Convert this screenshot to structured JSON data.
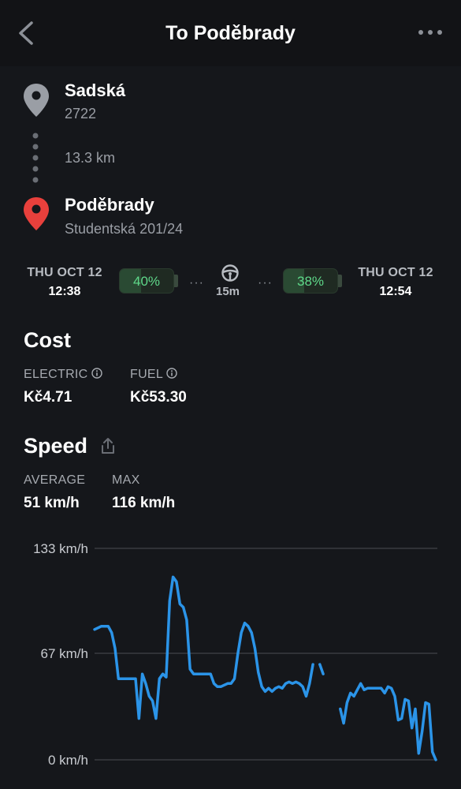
{
  "header": {
    "title": "To Poděbrady"
  },
  "route": {
    "origin": {
      "name": "Sadská",
      "address": "2722"
    },
    "distance": "13.3 km",
    "destination": {
      "name": "Poděbrady",
      "address": "Studentská 201/24"
    }
  },
  "trip": {
    "start": {
      "date": "THU OCT 12",
      "time": "12:38",
      "battery": "40%",
      "battery_level": 0.4
    },
    "duration": "15m",
    "end": {
      "date": "THU OCT 12",
      "time": "12:54",
      "battery": "38%",
      "battery_level": 0.38
    }
  },
  "cost": {
    "title": "Cost",
    "electric_label": "ELECTRIC",
    "electric_value": "Kč4.71",
    "fuel_label": "FUEL",
    "fuel_value": "Kč53.30"
  },
  "speed": {
    "title": "Speed",
    "average_label": "AVERAGE",
    "average_value": "51 km/h",
    "max_label": "MAX",
    "max_value": "116 km/h"
  },
  "colors": {
    "accent": "#2b94e8",
    "battery_text": "#5fd98a",
    "destination_pin": "#e8403c",
    "origin_pin": "#9a9ea5"
  },
  "chart_data": {
    "type": "line",
    "y_ticks": [
      "133 km/h",
      "67 km/h",
      "0 km/h"
    ],
    "ylim": [
      0,
      133
    ],
    "grid": true,
    "series": [
      {
        "segments": [
          [
            [
              0,
              82
            ],
            [
              2,
              84
            ],
            [
              4,
              84
            ],
            [
              5,
              80
            ],
            [
              6,
              70
            ],
            [
              7,
              51
            ],
            [
              8,
              51
            ],
            [
              9,
              51
            ],
            [
              10,
              51
            ],
            [
              11,
              51
            ],
            [
              12,
              51
            ],
            [
              13,
              26
            ],
            [
              14,
              54
            ],
            [
              15,
              48
            ],
            [
              16,
              40
            ],
            [
              17,
              37
            ],
            [
              18,
              26
            ],
            [
              19,
              51
            ],
            [
              20,
              54
            ],
            [
              21,
              52
            ],
            [
              22,
              100
            ],
            [
              23,
              115
            ],
            [
              24,
              112
            ],
            [
              25,
              98
            ],
            [
              26,
              96
            ],
            [
              27,
              88
            ],
            [
              28,
              57
            ],
            [
              29,
              54
            ],
            [
              30,
              54
            ],
            [
              31,
              54
            ],
            [
              32,
              54
            ],
            [
              33,
              54
            ],
            [
              34,
              54
            ],
            [
              35,
              48
            ],
            [
              36,
              46
            ],
            [
              37,
              46
            ],
            [
              38,
              47
            ],
            [
              39,
              48
            ],
            [
              40,
              48
            ],
            [
              41,
              51
            ],
            [
              42,
              67
            ],
            [
              43,
              80
            ],
            [
              44,
              86
            ],
            [
              45,
              84
            ],
            [
              46,
              80
            ],
            [
              47,
              70
            ],
            [
              48,
              55
            ],
            [
              49,
              46
            ],
            [
              50,
              43
            ],
            [
              51,
              45
            ],
            [
              52,
              43
            ],
            [
              53,
              45
            ],
            [
              54,
              46
            ],
            [
              55,
              45
            ],
            [
              56,
              48
            ],
            [
              57,
              49
            ],
            [
              58,
              48
            ],
            [
              59,
              49
            ],
            [
              60,
              48
            ],
            [
              61,
              46
            ],
            [
              62,
              40
            ],
            [
              63,
              48
            ],
            [
              64,
              60
            ]
          ],
          [
            [
              66,
              60
            ],
            [
              67,
              54
            ]
          ],
          [
            [
              72,
              32
            ],
            [
              73,
              23
            ],
            [
              74,
              36
            ],
            [
              75,
              42
            ],
            [
              76,
              40
            ],
            [
              77,
              44
            ],
            [
              78,
              48
            ],
            [
              79,
              44
            ],
            [
              80,
              45
            ],
            [
              81,
              45
            ],
            [
              82,
              45
            ],
            [
              83,
              45
            ],
            [
              84,
              45
            ],
            [
              85,
              42
            ],
            [
              86,
              46
            ],
            [
              87,
              45
            ],
            [
              88,
              40
            ],
            [
              89,
              25
            ],
            [
              90,
              26
            ],
            [
              91,
              38
            ],
            [
              92,
              37
            ],
            [
              93,
              20
            ],
            [
              94,
              32
            ],
            [
              95,
              4
            ],
            [
              96,
              18
            ],
            [
              97,
              36
            ],
            [
              98,
              35
            ],
            [
              99,
              5
            ],
            [
              100,
              0
            ]
          ]
        ]
      }
    ]
  }
}
